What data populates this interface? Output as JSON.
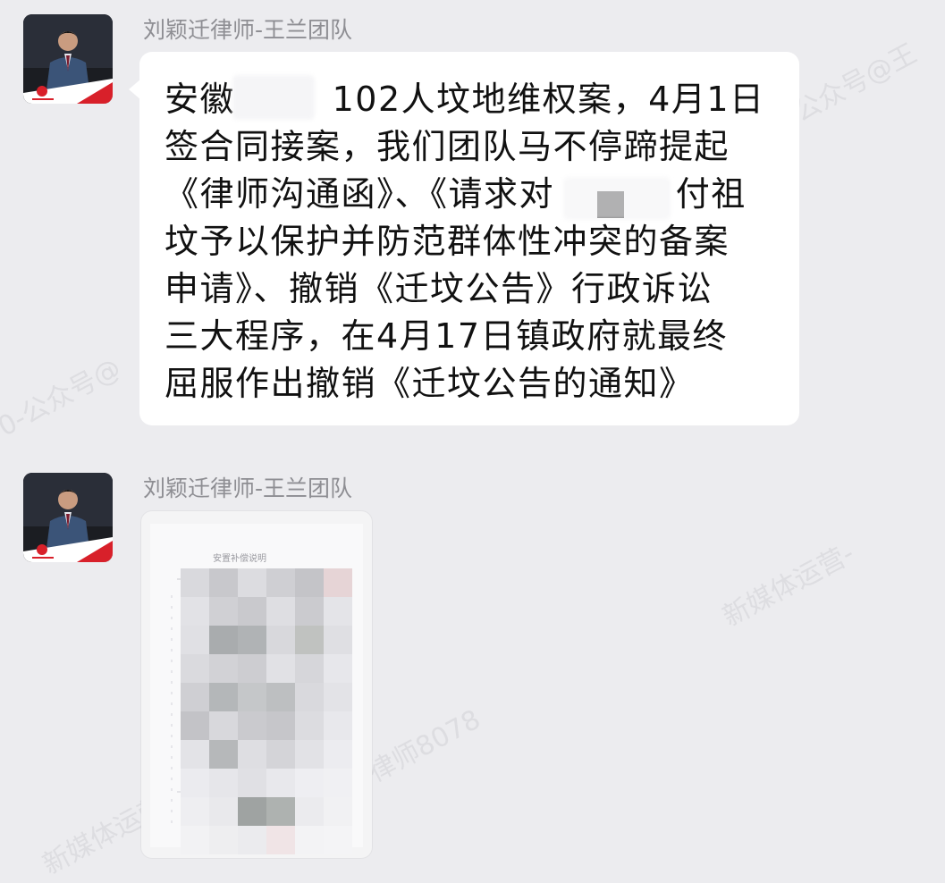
{
  "messages": [
    {
      "sender": "刘颖迁律师-王兰团队",
      "type": "text",
      "text_lines": [
        "安徽        102人坟地维权案，4月1日",
        "签合同接案，我们团队马不停蹄提起",
        "《律师沟通函》、《请求对          付祖",
        "坟予以保护并防范群体性冲突的备案",
        "申请》、撤销《迁坟公告》行政诉讼",
        "三大程序，在4月17日镇政府就最终",
        "屈服作出撤销《迁坟公告的通知》"
      ]
    },
    {
      "sender": "刘颖迁律师-王兰团队",
      "type": "image",
      "doc_title": "安置补偿说明"
    }
  ],
  "watermarks": [
    "公众号@王",
    "新媒体运营-",
    "律师8078",
    "新媒体运营",
    "0-公众号@"
  ],
  "colors": {
    "background": "#ececef",
    "bubble": "#ffffff",
    "sender_name": "#8e8e93",
    "avatar_red": "#d8202a"
  }
}
